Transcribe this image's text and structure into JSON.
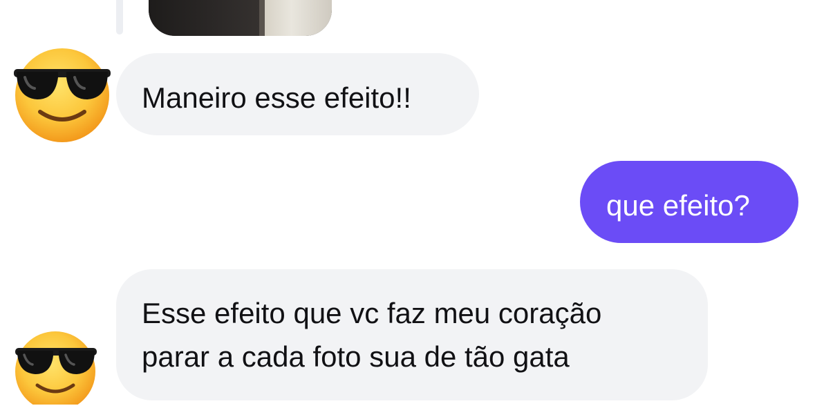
{
  "messages": [
    {
      "sender": "contact",
      "text": "Maneiro esse efeito!!"
    },
    {
      "sender": "me",
      "text": "que efeito?"
    },
    {
      "sender": "contact",
      "lines": [
        "Esse efeito que vc faz meu coração",
        "parar a cada foto sua de tão gata"
      ]
    }
  ],
  "avatar": {
    "icon": "sunglasses-emoji-icon"
  },
  "colors": {
    "incoming_bubble": "#f2f3f5",
    "outgoing_bubble": "#6b4cf6",
    "incoming_text": "#111114",
    "outgoing_text": "#ffffff"
  }
}
